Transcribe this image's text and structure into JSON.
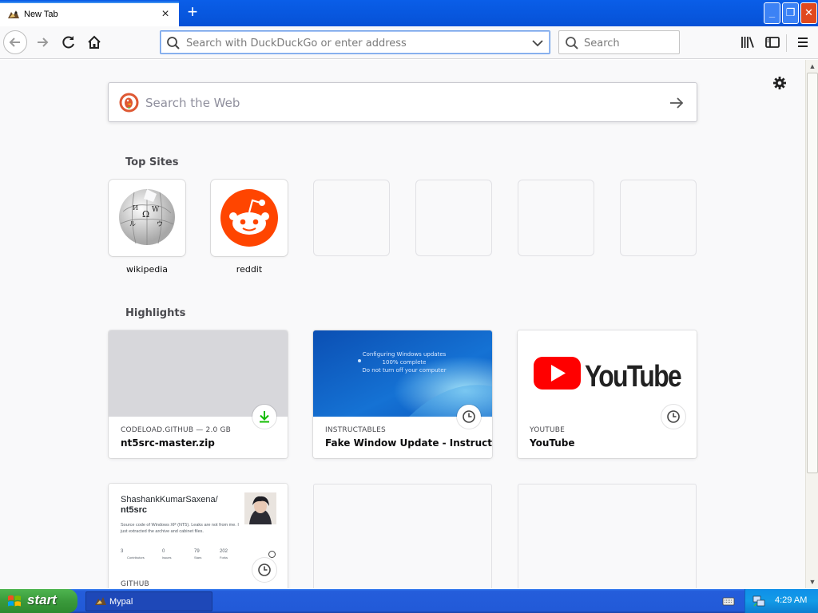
{
  "tab": {
    "title": "New Tab",
    "close_icon": "close-icon",
    "new_tab_icon": "plus-icon"
  },
  "window_controls": {
    "minimize": "minimize-icon",
    "maximize": "restore-icon",
    "close": "close-icon"
  },
  "toolbar": {
    "url_placeholder": "Search with DuckDuckGo or enter address",
    "search_placeholder": "Search"
  },
  "newtab": {
    "search_placeholder": "Search the Web",
    "top_sites_title": "Top Sites",
    "top_sites": [
      {
        "label": "wikipedia"
      },
      {
        "label": "reddit"
      }
    ],
    "highlights_title": "Highlights",
    "highlights": [
      {
        "source": "CODELOAD.GITHUB — 2.0 GB",
        "title": "nt5src-master.zip",
        "badge": "download-icon"
      },
      {
        "source": "INSTRUCTABLES",
        "title": "Fake Window Update - Instructa...",
        "badge": "clock-icon",
        "thumb_lines": [
          "Configuring Windows updates",
          "100% complete",
          "Do not turn off your computer"
        ]
      },
      {
        "source": "YOUTUBE",
        "title": "YouTube",
        "badge": "clock-icon",
        "thumb_text": "YouTube"
      },
      {
        "source": "GITHUB",
        "badge": "clock-icon",
        "thumb_title": "ShashankKumarSaxena/",
        "thumb_title_bold": "nt5src",
        "thumb_desc": "Source code of Windows XP (NT5). Leaks are not from me. I just extracted the archive and cabinet files.",
        "thumb_stats": [
          {
            "value": "3",
            "label": "Contributors"
          },
          {
            "value": "0",
            "label": "Issues"
          },
          {
            "value": "79",
            "label": "Stars"
          },
          {
            "value": "202",
            "label": "Forks"
          }
        ]
      }
    ]
  },
  "taskbar": {
    "start_label": "start",
    "task_label": "Mypal",
    "clock": "4:29 AM"
  },
  "colors": {
    "accent": "#0a5ee8",
    "reddit": "#ff4500",
    "youtube": "#ff0000",
    "download": "#12bc00"
  }
}
